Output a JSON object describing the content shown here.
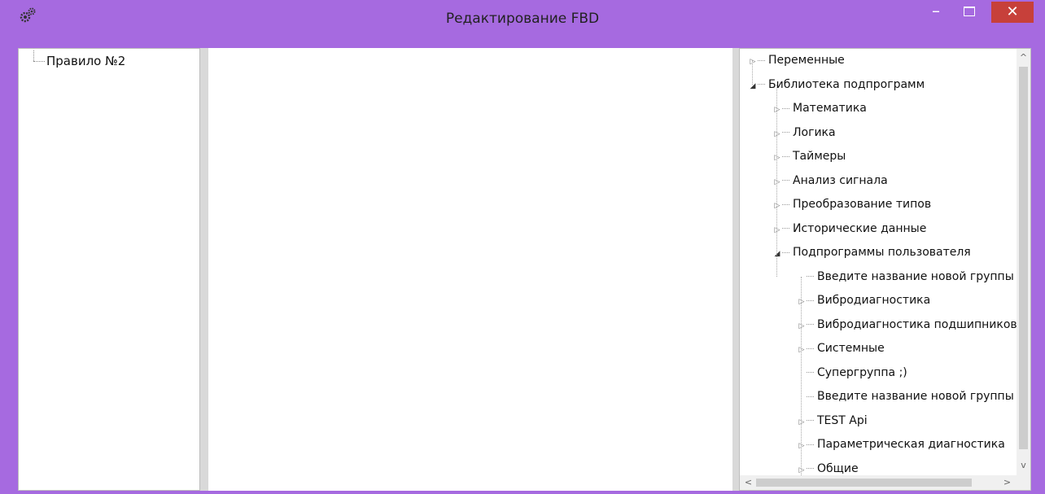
{
  "window": {
    "title": "Редактирование FBD",
    "icon": "gears-icon",
    "controls": {
      "minimize": "–",
      "close": "✕"
    }
  },
  "left_tree": {
    "items": [
      {
        "label": "Правило №2"
      }
    ]
  },
  "right_tree": {
    "nodes": [
      {
        "label": "Переменные",
        "level": 0,
        "expander": "collapsed"
      },
      {
        "label": "Библиотека подпрограмм",
        "level": 0,
        "expander": "expanded"
      },
      {
        "label": "Математика",
        "level": 1,
        "expander": "collapsed"
      },
      {
        "label": "Логика",
        "level": 1,
        "expander": "collapsed"
      },
      {
        "label": "Таймеры",
        "level": 1,
        "expander": "collapsed"
      },
      {
        "label": "Анализ сигнала",
        "level": 1,
        "expander": "collapsed"
      },
      {
        "label": "Преобразование типов",
        "level": 1,
        "expander": "collapsed"
      },
      {
        "label": "Исторические данные",
        "level": 1,
        "expander": "collapsed"
      },
      {
        "label": "Подпрограммы пользователя",
        "level": 1,
        "expander": "expanded"
      },
      {
        "label": "Введите название новой группы",
        "level": 2,
        "expander": "none"
      },
      {
        "label": "Вибродиагностика",
        "level": 2,
        "expander": "collapsed"
      },
      {
        "label": "Вибродиагностика подшипников",
        "level": 2,
        "expander": "collapsed"
      },
      {
        "label": "Системные",
        "level": 2,
        "expander": "collapsed"
      },
      {
        "label": "Супергруппа ;)",
        "level": 2,
        "expander": "none"
      },
      {
        "label": "Введите название новой группы",
        "level": 2,
        "expander": "none"
      },
      {
        "label": "TEST Api",
        "level": 2,
        "expander": "collapsed"
      },
      {
        "label": "Параметрическая диагностика",
        "level": 2,
        "expander": "collapsed"
      },
      {
        "label": "Общие",
        "level": 2,
        "expander": "collapsed"
      }
    ]
  },
  "colors": {
    "frame": "#a66ae0",
    "close_button": "#c7403a",
    "splitter": "#d9d9d9"
  }
}
